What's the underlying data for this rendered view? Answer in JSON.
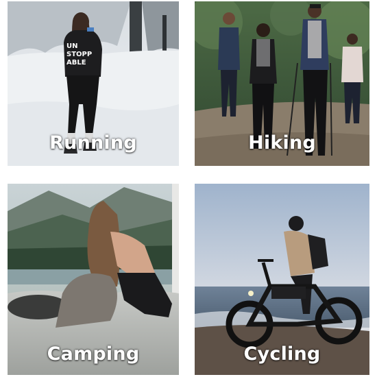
{
  "activities": [
    {
      "label": "Running",
      "shirt_text_line1": "UN",
      "shirt_text_line2": "STOPP",
      "shirt_text_line3": "ABLE"
    },
    {
      "label": "Hiking"
    },
    {
      "label": "Camping"
    },
    {
      "label": "Cycling"
    }
  ],
  "colors": {
    "caption_text": "#ffffff",
    "snow": "#e9ecef",
    "forest_green": "#3f5a3c",
    "sunset_sky": "#c8d3e3",
    "sea": "#5f7287"
  }
}
